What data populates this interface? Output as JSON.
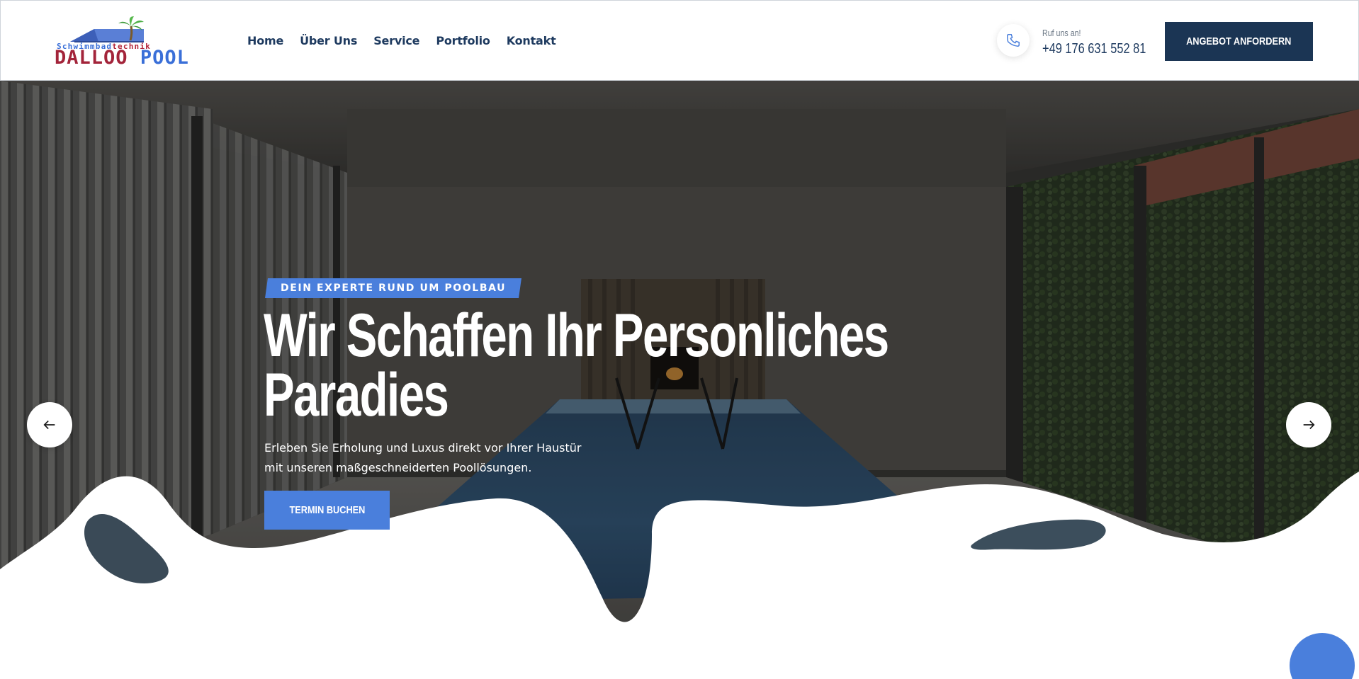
{
  "brand": {
    "subtitle_part1": "Schwimmbad",
    "subtitle_part2": "technik",
    "name_part1": "DALLOO",
    "name_part2": "POOL"
  },
  "nav": {
    "items": [
      {
        "label": "Home"
      },
      {
        "label": "Über Uns"
      },
      {
        "label": "Service"
      },
      {
        "label": "Portfolio"
      },
      {
        "label": "Kontakt"
      }
    ]
  },
  "contact": {
    "label": "Ruf uns an!",
    "phone": "+49 176 631 552 81",
    "icon": "phone-icon"
  },
  "header_cta": {
    "label": "ANGEBOT ANFORDERN"
  },
  "hero": {
    "kicker": "DEIN EXPERTE RUND UM POOLBAU",
    "headline_line1": "Wir Schaffen Ihr Personliches",
    "headline_line2": "Paradies",
    "subtext": "Erleben Sie Erholung und Luxus direkt vor Ihrer Haustür mit unseren maßgeschneiderten Poollösungen.",
    "cta_label": "TERMIN BUCHEN",
    "prev_icon": "arrow-left-icon",
    "next_icon": "arrow-right-icon"
  },
  "colors": {
    "navy": "#1b3554",
    "accent_blue": "#4a7fdc",
    "logo_red": "#a3243a"
  }
}
